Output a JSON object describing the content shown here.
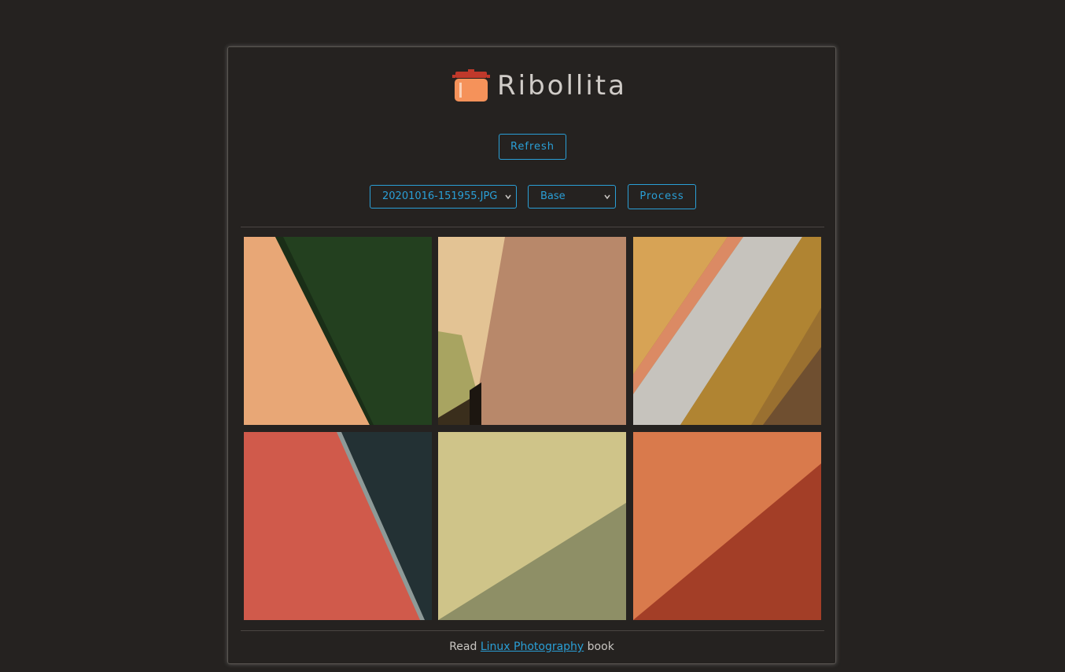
{
  "app": {
    "title": "Ribollita",
    "logo_icon": "cooking-pot-icon"
  },
  "toolbar": {
    "refresh_label": "Refresh",
    "file_select_value": "20201016-151955.JPG",
    "preset_select_value": "Base",
    "process_label": "Process"
  },
  "gallery": {
    "images": [
      {
        "name": "peach-green-wall"
      },
      {
        "name": "tan-brown-corner"
      },
      {
        "name": "ochre-stripes"
      },
      {
        "name": "red-dark-wall"
      },
      {
        "name": "yellow-olive-shadow"
      },
      {
        "name": "orange-rust-wall"
      }
    ]
  },
  "footer": {
    "prefix": "Read",
    "link_text": "Linux Photography",
    "suffix": "book"
  },
  "colors": {
    "accent": "#2a9fd6",
    "background": "#252220",
    "pot_orange": "#f5925a",
    "pot_lid": "#c0392b"
  }
}
